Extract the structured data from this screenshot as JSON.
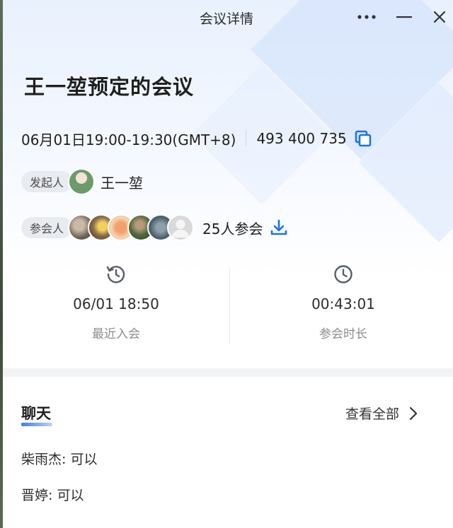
{
  "window": {
    "title": "会议详情"
  },
  "meeting": {
    "title": "王一堃预定的会议",
    "time": "06月01日19:00-19:30(GMT+8)",
    "meeting_id": "493 400 735"
  },
  "organizer": {
    "tag": "发起人",
    "name": "王一堃",
    "avatar_icon": "organizer-avatar"
  },
  "participants": {
    "tag": "参会人",
    "count_text": "25人参会",
    "avatar_icons": [
      "cat-avatar",
      "sunflower-avatar",
      "cartoon-avatar",
      "landscape-avatar",
      "portrait-avatar",
      "default-avatar"
    ]
  },
  "stats": {
    "recent_join": {
      "value": "06/01 18:50",
      "label": "最近入会",
      "icon": "history-icon"
    },
    "duration": {
      "value": "00:43:01",
      "label": "参会时长",
      "icon": "clock-icon"
    }
  },
  "chat": {
    "title": "聊天",
    "view_all": "查看全部",
    "messages": [
      {
        "text": "柴雨杰: 可以"
      },
      {
        "text": "晋婷: 可以"
      }
    ]
  },
  "colors": {
    "accent": "#1a73e8",
    "tag_bg": "#e8ebf0",
    "muted_text": "#8c8c8c"
  }
}
